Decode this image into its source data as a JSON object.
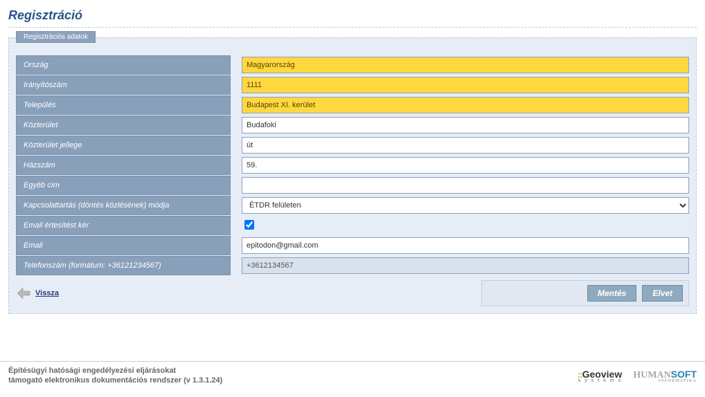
{
  "page": {
    "title": "Regisztráció",
    "panel_tab": "Regisztrációs adatok"
  },
  "labels": {
    "country": "Ország",
    "zip": "Irányítószám",
    "city": "Település",
    "street": "Közterület",
    "street_type": "Közterület jellege",
    "house": "Házszám",
    "other": "Egyéb cím",
    "contact_method": "Kapcsolattartás (döntés közlésének) módja",
    "email_notify": "Email értesítést kér",
    "email": "Email",
    "phone": "Telefonszám (formátum: +36121234567)"
  },
  "values": {
    "country": "Magyarország",
    "zip": "1111",
    "city": "Budapest XI. kerület",
    "street": "Budafoki",
    "street_type": "út",
    "house": "59.",
    "other": "",
    "contact_method": "ÉTDR felületen",
    "email_notify": true,
    "email": "epitodon@gmail.com",
    "phone": "+3612134567"
  },
  "buttons": {
    "back": "Vissza",
    "save": "Mentés",
    "discard": "Elvet"
  },
  "footer": {
    "line1": "Építésügyi hatósági engedélyezési eljárásokat",
    "line2": "támogató elektronikus dokumentációs rendszer (v 1.3.1.24)"
  }
}
